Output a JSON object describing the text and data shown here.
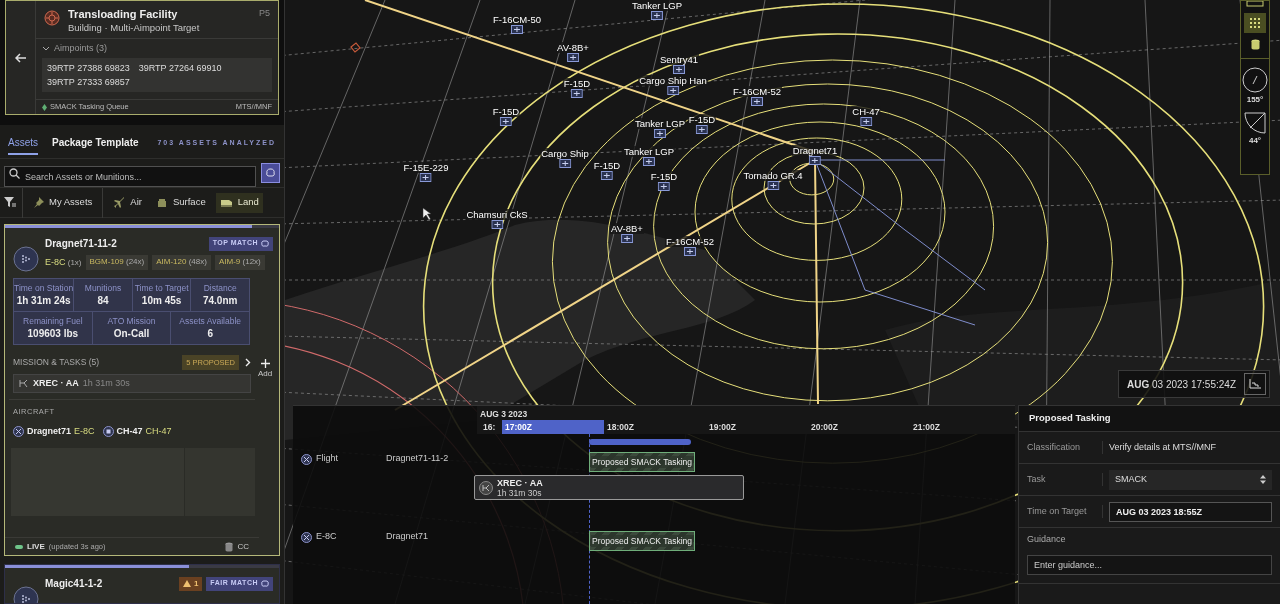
{
  "target": {
    "title": "Transloading Facility",
    "subtitle": "Building · Multi-Aimpoint Target",
    "priority": "P5",
    "aimpoints_label": "Aimpoints (3)",
    "expanded": true,
    "aimpoints": [
      "39RTP 27388 69823",
      "39RTP 27264 69910",
      "39RTP 27333 69857"
    ],
    "queue": "SMACK Tasking Queue",
    "classification": "MTS//MNF"
  },
  "tabs": [
    {
      "label": "Assets",
      "selected": true
    },
    {
      "label": "Package Template",
      "selected": false
    }
  ],
  "assets_analyzed": "703 ASSETS ANALYZED",
  "search": {
    "placeholder": "Search Assets or Munitions..."
  },
  "filters": [
    {
      "kind": "pin",
      "label": "My Assets",
      "selected": false
    },
    {
      "kind": "air",
      "label": "Air",
      "selected": false
    },
    {
      "kind": "surface",
      "label": "Surface",
      "selected": false
    },
    {
      "kind": "land",
      "label": "Land",
      "selected": true
    }
  ],
  "asset_cards": [
    {
      "name": "Dragnet71-11-2",
      "level": 0.9,
      "match": "TOP MATCH",
      "platform": "E-8C",
      "platform_count": "(1x)",
      "munitions": [
        {
          "name": "BGM-109",
          "count": "(24x)"
        },
        {
          "name": "AIM-120",
          "count": "(48x)"
        },
        {
          "name": "AIM-9",
          "count": "(12x)"
        }
      ],
      "stats": [
        [
          {
            "label": "Time on Station",
            "value": "1h 31m 24s"
          },
          {
            "label": "Munitions",
            "value": "84"
          },
          {
            "label": "Time to Target",
            "value": "10m 45s"
          },
          {
            "label": "Distance",
            "value": "74.0nm"
          }
        ],
        [
          {
            "label": "Remaining Fuel",
            "value": "109603 lbs"
          },
          {
            "label": "ATO Mission",
            "value": "On-Call"
          },
          {
            "label": "Assets Available",
            "value": "6"
          }
        ]
      ],
      "missions_label": "MISSION & TASKS (5)",
      "proposed": "5 PROPOSED",
      "add": "Add",
      "task": {
        "name": "XREC · AA",
        "duration": "1h 31m 30s"
      },
      "aircraft_label": "AIRCRAFT",
      "aircraft": [
        {
          "callsign": "Dragnet71",
          "type": "E-8C"
        },
        {
          "callsign": "CH-47",
          "type": "CH-47"
        }
      ],
      "status": "LIVE",
      "updated": "(updated 3s ago)",
      "cc": "CC"
    },
    {
      "name": "Magic41-1-2",
      "level": 0.67,
      "warning": "1",
      "match": "FAIR MATCH"
    }
  ],
  "map": {
    "labels": [
      "Tanker LGP",
      "F-16CM-50",
      "AV-8B+",
      "Sentry41",
      "F-15D",
      "Cargo Ship Han",
      "F-16CM-52",
      "CH-47",
      "F-15D",
      "Tanker LGP",
      "F-15D",
      "Cargo Ship",
      "Tanker LGP",
      "Dragnet71",
      "F-15D",
      "F-15D",
      "Tornado GR.4",
      "F-15E-229",
      "Chamsuri CkS",
      "AV-8B+",
      "F-16CM-52"
    ],
    "date_time": "**AUG** 03 2023 17:55:24Z",
    "heading": "155°",
    "tilt": "44°"
  },
  "timeline": {
    "date": "AUG 3 2023",
    "ticks": [
      {
        "label": "16:",
        "selected": false
      },
      {
        "label": "17:00Z",
        "selected": true
      },
      {
        "label": "18:00Z",
        "selected": false
      },
      {
        "label": "19:00Z",
        "selected": false
      },
      {
        "label": "20:00Z",
        "selected": false
      },
      {
        "label": "21:00Z",
        "selected": false
      }
    ],
    "rows": [
      {
        "kind": "asset",
        "type": "Flight",
        "name": "Dragnet71-11-2",
        "task": "Proposed SMACK Tasking"
      },
      {
        "kind": "mission",
        "title": "XREC · AA",
        "duration": "1h 31m 30s"
      },
      {
        "kind": "asset",
        "type": "E-8C",
        "name": "Dragnet71",
        "task": "Proposed SMACK Tasking"
      }
    ]
  },
  "proposed_tasking": {
    "title": "Proposed Tasking",
    "fields": [
      {
        "kind": "text",
        "label": "Classification",
        "value": "Verify details at MTS//MNF"
      },
      {
        "kind": "select",
        "label": "Task",
        "value": "SMACK"
      },
      {
        "kind": "input",
        "label": "Time on Target",
        "value": "AUG 03 2023 18:55Z"
      },
      {
        "kind": "textarea",
        "label": "Guidance",
        "placeholder": "Enter guidance..."
      }
    ]
  }
}
